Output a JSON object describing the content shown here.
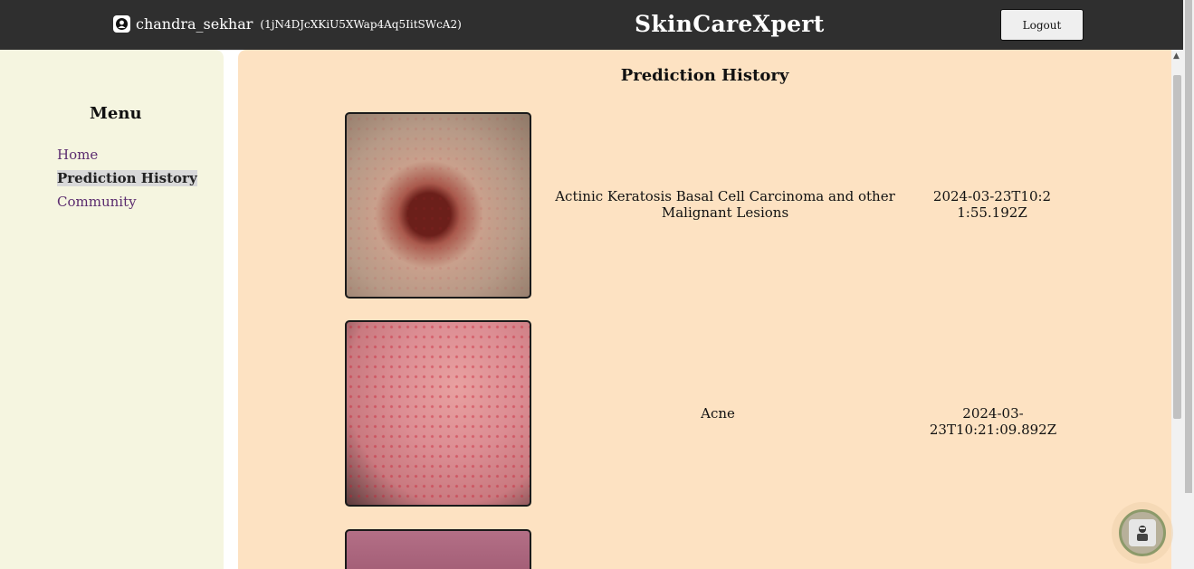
{
  "header": {
    "username": "chandra_sekhar",
    "user_id": "(1jN4DJcXKiU5XWap4Aq5IitSWcA2)",
    "brand": "SkinCareXpert",
    "logout_label": "Logout"
  },
  "sidebar": {
    "title": "Menu",
    "items": [
      {
        "label": "Home"
      },
      {
        "label": "Prediction History"
      },
      {
        "label": "Community"
      }
    ]
  },
  "main": {
    "title": "Prediction History",
    "records": [
      {
        "disease": "Actinic Keratosis Basal Cell Carcinoma and other Malignant Lesions",
        "date": "2024-03-23T10:21:55.192Z"
      },
      {
        "disease": "Acne",
        "date": "2024-03-23T10:21:09.892Z"
      }
    ]
  },
  "icons": {
    "user": "user-account-icon",
    "assistant": "chatbot-avatar-icon"
  },
  "colors": {
    "header_bg": "#2f2f2f",
    "sidebar_bg": "#f5f5e0",
    "main_bg": "#fde2c2",
    "link": "#5b2c6f"
  }
}
